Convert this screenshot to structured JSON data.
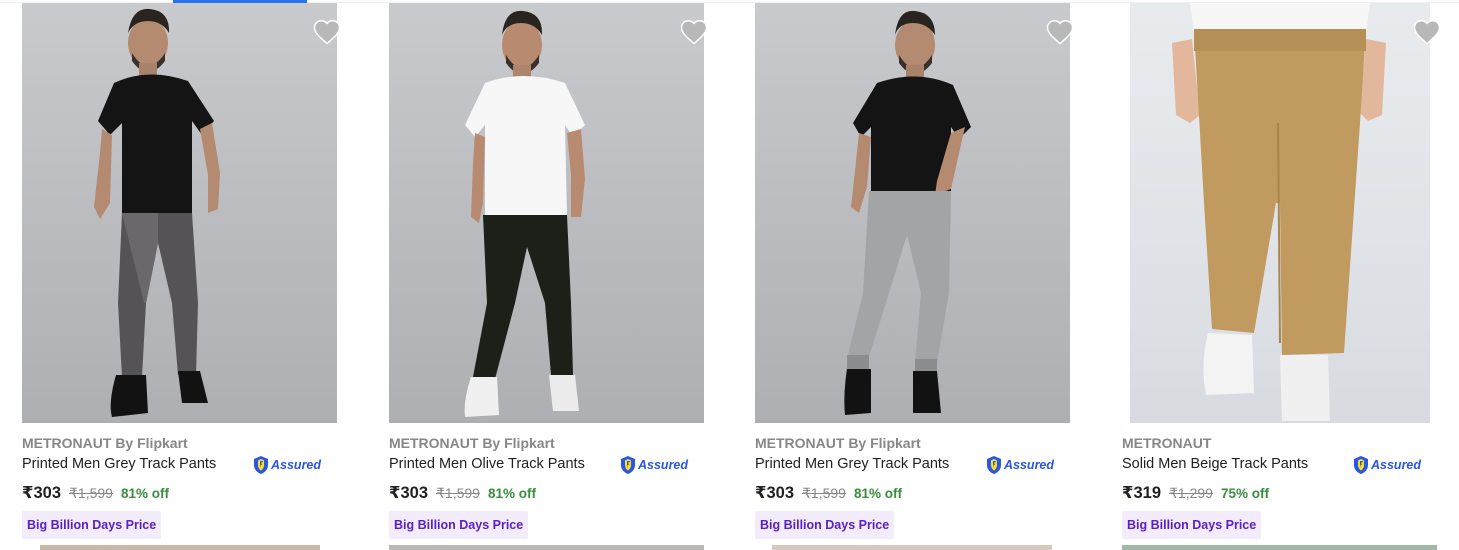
{
  "products": [
    {
      "brand": "METRONAUT By Flipkart",
      "title": "Printed Men Grey Track Pants",
      "assured": "Assured",
      "price": "₹303",
      "mrp": "₹1,599",
      "discount": "81% off",
      "offer": "Big Billion Days Price"
    },
    {
      "brand": "METRONAUT By Flipkart",
      "title": "Printed Men Olive Track Pants",
      "assured": "Assured",
      "price": "₹303",
      "mrp": "₹1,599",
      "discount": "81% off",
      "offer": "Big Billion Days Price"
    },
    {
      "brand": "METRONAUT By Flipkart",
      "title": "Printed Men Grey Track Pants",
      "assured": "Assured",
      "price": "₹303",
      "mrp": "₹1,599",
      "discount": "81% off",
      "offer": "Big Billion Days Price"
    },
    {
      "brand": "METRONAUT",
      "title": "Solid Men Beige Track Pants",
      "assured": "Assured",
      "price": "₹319",
      "mrp": "₹1,299",
      "discount": "75% off",
      "offer": "Big Billion Days Price"
    }
  ],
  "colors": {
    "accent": "#2874f0",
    "discount": "#388e3c",
    "offer_text": "#5a20c8",
    "assured": "#2a55e5"
  },
  "icons": {
    "wishlist": "heart-icon",
    "assured": "flipkart-assured-shield-icon"
  }
}
